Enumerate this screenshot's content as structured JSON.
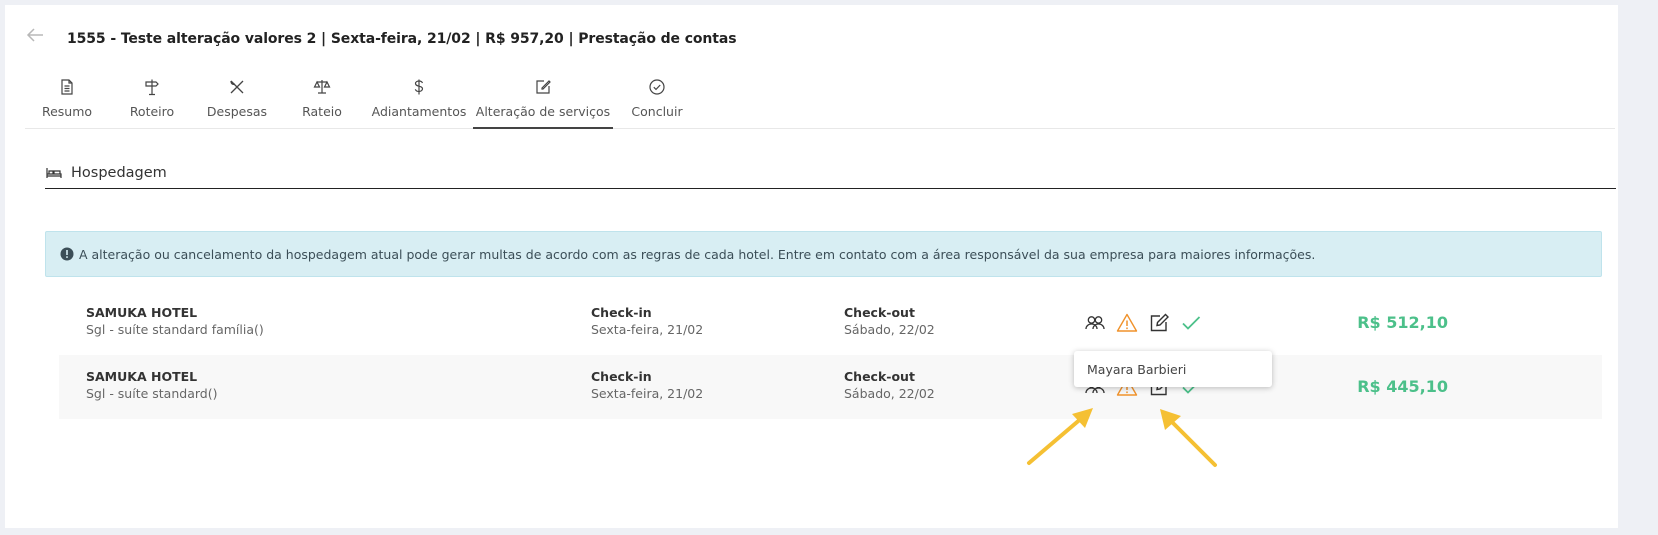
{
  "header": {
    "title": "1555 - Teste alteração valores 2 | Sexta-feira, 21/02 | R$ 957,20 | Prestação de contas"
  },
  "tabs": [
    {
      "label": "Resumo",
      "icon": "document-icon"
    },
    {
      "label": "Roteiro",
      "icon": "signpost-icon"
    },
    {
      "label": "Despesas",
      "icon": "utensils-icon"
    },
    {
      "label": "Rateio",
      "icon": "balance-scale-icon"
    },
    {
      "label": "Adiantamentos",
      "icon": "dollar-icon"
    },
    {
      "label": "Alteração de serviços",
      "icon": "edit-icon",
      "active": true
    },
    {
      "label": "Concluir",
      "icon": "check-circle-icon"
    }
  ],
  "section": {
    "title": "Hospedagem",
    "icon": "bed-icon"
  },
  "alert": {
    "text": "A alteração ou cancelamento da hospedagem atual pode gerar multas de acordo com as regras de cada hotel. Entre em contato com a área responsável da sua empresa para maiores informações.",
    "icon": "exclamation-circle-icon"
  },
  "bookings": [
    {
      "hotel": "SAMUKA HOTEL",
      "room": "Sgl - suíte standard família()",
      "checkin_label": "Check-in",
      "checkin_date": "Sexta-feira, 21/02",
      "checkout_label": "Check-out",
      "checkout_date": "Sábado, 22/02",
      "price": "R$ 512,10"
    },
    {
      "hotel": "SAMUKA HOTEL",
      "room": "Sgl - suíte standard()",
      "checkin_label": "Check-in",
      "checkin_date": "Sexta-feira, 21/02",
      "checkout_label": "Check-out",
      "checkout_date": "Sábado, 22/02",
      "price": "R$ 445,10"
    }
  ],
  "tooltip": {
    "text": "Mayara Barbieri"
  },
  "colors": {
    "accent_green": "#4cc08a",
    "warning_orange": "#f0922b",
    "alert_bg": "#d8eef3",
    "annotation_yellow": "#f5c033"
  }
}
